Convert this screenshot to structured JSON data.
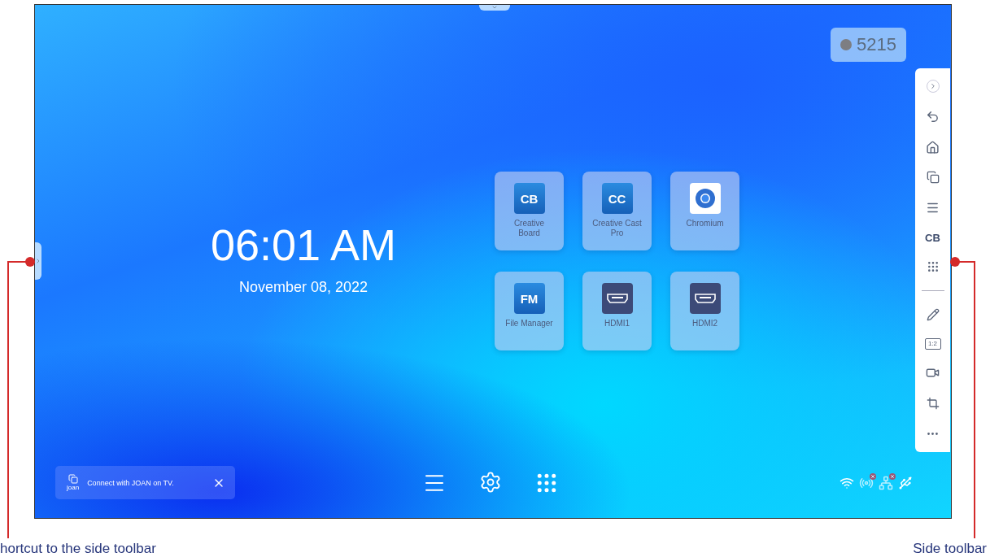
{
  "badge": {
    "text": "5215"
  },
  "clock": {
    "time": "06:01 AM",
    "date": "November 08, 2022"
  },
  "apps": [
    {
      "name": "Creative Board",
      "kind": "text",
      "icon_text": "CB"
    },
    {
      "name": "Creative Cast Pro",
      "kind": "text",
      "icon_text": "CC"
    },
    {
      "name": "Chromium",
      "kind": "browser"
    },
    {
      "name": "File Manager",
      "kind": "text",
      "icon_text": "FM"
    },
    {
      "name": "HDMI1",
      "kind": "hdmi"
    },
    {
      "name": "HDMI2",
      "kind": "hdmi"
    }
  ],
  "side_toolbar": [
    {
      "kind": "collapse"
    },
    {
      "kind": "back"
    },
    {
      "kind": "home"
    },
    {
      "kind": "windows"
    },
    {
      "kind": "menu"
    },
    {
      "kind": "text",
      "label": "CB"
    },
    {
      "kind": "apps"
    },
    {
      "kind": "divider"
    },
    {
      "kind": "pen"
    },
    {
      "kind": "ratio",
      "label": "1:2"
    },
    {
      "kind": "record"
    },
    {
      "kind": "crop"
    },
    {
      "kind": "more"
    }
  ],
  "toast": {
    "text": "Connect with JOAN on TV.",
    "logo_text": "joan"
  },
  "dock": [
    {
      "kind": "menu"
    },
    {
      "kind": "settings"
    },
    {
      "kind": "apps"
    }
  ],
  "tray": [
    {
      "kind": "wifi",
      "error": false
    },
    {
      "kind": "hotspot",
      "error": true
    },
    {
      "kind": "ethernet",
      "error": true
    },
    {
      "kind": "usb",
      "error": false
    }
  ],
  "annotations": [
    {
      "text": "hortcut to the side toolbar"
    },
    {
      "text": "Side toolbar"
    }
  ]
}
